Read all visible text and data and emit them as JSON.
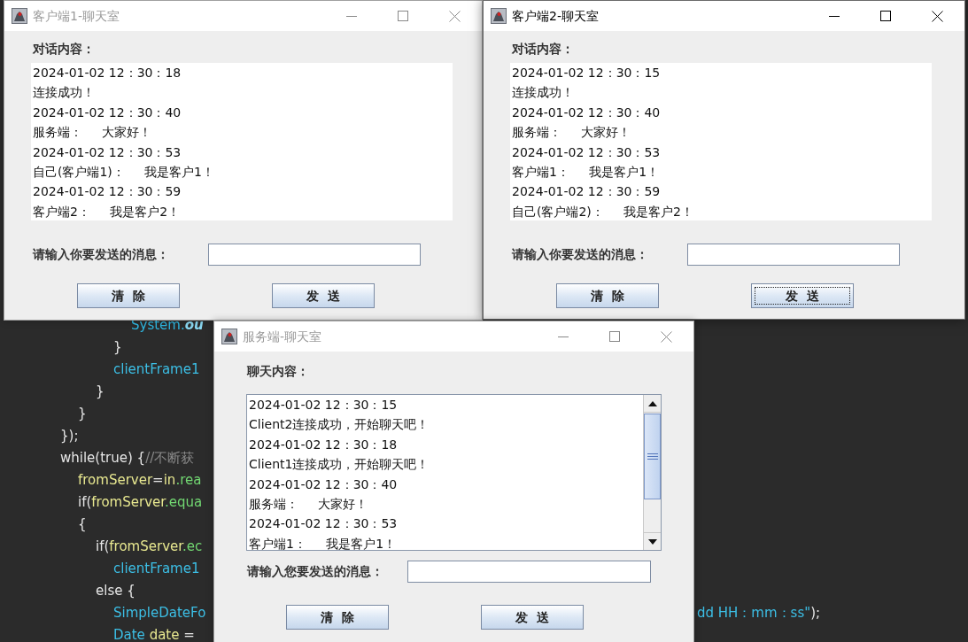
{
  "code_editor": {
    "lines": [
      {
        "tokens": [
          {
            "text": "\t\t\t\tSystem.",
            "color": "#2fb6e0"
          },
          {
            "text": "ou",
            "color": "#8ad8f2",
            "italic": true
          }
        ]
      },
      {
        "tokens": [
          {
            "text": "\t\t\t}",
            "color": "#e6e6e6"
          }
        ]
      },
      {
        "tokens": [
          {
            "text": "\t\t\tclientFrame1",
            "color": "#3cbfe6"
          }
        ]
      },
      {
        "tokens": [
          {
            "text": "\t\t}",
            "color": "#e6e6e6"
          }
        ]
      },
      {
        "tokens": [
          {
            "text": "\t}",
            "color": "#e6e6e6"
          }
        ]
      },
      {
        "tokens": [
          {
            "text": "});",
            "color": "#e6e6e6"
          }
        ]
      },
      {
        "tokens": [
          {
            "text": "while(true) {",
            "color": "#e6e6e6"
          },
          {
            "text": "//不断获",
            "color": "#8a8a8a"
          }
        ]
      },
      {
        "tokens": [
          {
            "text": "\tfromServer",
            "color": "#e8e890"
          },
          {
            "text": "=",
            "color": "#e6e6e6"
          },
          {
            "text": "in",
            "color": "#e8e890"
          },
          {
            "text": ".rea",
            "color": "#72d872"
          }
        ]
      },
      {
        "tokens": [
          {
            "text": "\tif(",
            "color": "#e6e6e6"
          },
          {
            "text": "fromServer",
            "color": "#e8e890"
          },
          {
            "text": ".equa",
            "color": "#72d872"
          }
        ]
      },
      {
        "tokens": [
          {
            "text": "\t{",
            "color": "#e6e6e6"
          }
        ]
      },
      {
        "tokens": [
          {
            "text": "\t\tif(",
            "color": "#e6e6e6"
          },
          {
            "text": "fromServer",
            "color": "#e8e890"
          },
          {
            "text": ".ec",
            "color": "#72d872"
          }
        ]
      },
      {
        "tokens": [
          {
            "text": "\t\t\tclientFrame1",
            "color": "#3cbfe6"
          }
        ]
      },
      {
        "tokens": [
          {
            "text": "\t\telse {",
            "color": "#e6e6e6"
          }
        ]
      },
      {
        "tokens": [
          {
            "text": "\t\t\tSimpleDateFo",
            "color": "#3cbfe6"
          }
        ]
      },
      {
        "tokens": [
          {
            "text": "\t\t\tDate",
            "color": "#3cbfe6"
          },
          {
            "text": " date",
            "color": "#e8e890"
          },
          {
            "text": " =",
            "color": "#e6e6e6"
          }
        ]
      }
    ],
    "right_fragment": {
      "tokens": [
        {
          "text": "dd HH：mm：ss\"",
          "color": "#3cbfe6"
        },
        {
          "text": ");",
          "color": "#e6e6e6"
        }
      ]
    }
  },
  "windows": [
    {
      "title": "客户端1-聊天室",
      "active": false,
      "content_label": "对话内容：",
      "messages": {
        "kind": "plain",
        "lines": [
          "2024-01-02 12：30：18",
          "连接成功！",
          "2024-01-02 12：30：40",
          "服务端：     大家好！",
          "2024-01-02 12：30：53",
          "自己(客户端1)：     我是客户1！",
          "2024-01-02 12：30：59",
          "客户端2：     我是客户2！"
        ]
      },
      "input_label": "请输入你要发送的消息：",
      "buttons": [
        {
          "label": "清  除",
          "focused": false
        },
        {
          "label": "发  送",
          "focused": false
        }
      ]
    },
    {
      "title": "客户端2-聊天室",
      "active": true,
      "content_label": "对话内容：",
      "messages": {
        "kind": "plain",
        "lines": [
          "2024-01-02 12：30：15",
          "连接成功！",
          "2024-01-02 12：30：40",
          "服务端：     大家好！",
          "2024-01-02 12：30：53",
          "客户端1：     我是客户1！",
          "2024-01-02 12：30：59",
          "自己(客户端2)：     我是客户2！"
        ]
      },
      "input_label": "请输入你要发送的消息：",
      "buttons": [
        {
          "label": "清  除",
          "focused": false
        },
        {
          "label": "发  送",
          "focused": true
        }
      ]
    },
    {
      "title": "服务端-聊天室",
      "active": false,
      "content_label": "聊天内容：",
      "messages": {
        "kind": "scrolling",
        "lines": [
          "2024-01-02 12：30：15",
          "Client2连接成功，开始聊天吧！",
          "2024-01-02 12：30：18",
          "Client1连接成功，开始聊天吧！",
          "2024-01-02 12：30：40",
          "服务端：     大家好！",
          "2024-01-02 12：30：53",
          "客户端1：     我是客户1！"
        ]
      },
      "input_label": "请输入您要发送的消息：",
      "buttons": [
        {
          "label": "清  除",
          "focused": false
        },
        {
          "label": "发  送",
          "focused": false
        }
      ]
    }
  ]
}
